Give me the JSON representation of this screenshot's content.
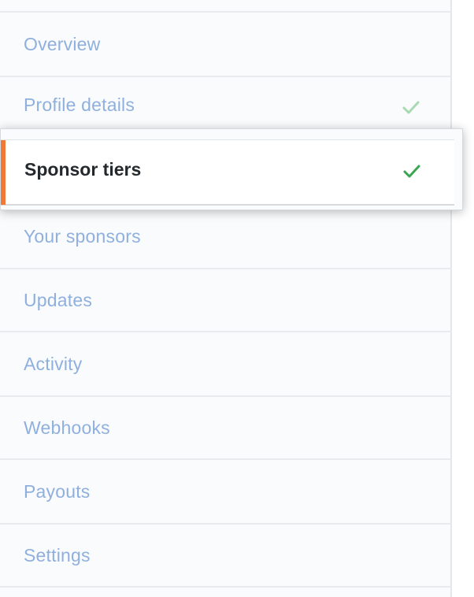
{
  "menu": {
    "items": [
      {
        "label": "Overview",
        "checked": false
      },
      {
        "label": "Profile details",
        "checked": true
      },
      {
        "label": "Sponsor tiers",
        "checked": true,
        "selected": true
      },
      {
        "label": "Your sponsors",
        "checked": false
      },
      {
        "label": "Updates",
        "checked": false
      },
      {
        "label": "Activity",
        "checked": false
      },
      {
        "label": "Webhooks",
        "checked": false
      },
      {
        "label": "Payouts",
        "checked": false
      },
      {
        "label": "Settings",
        "checked": false
      }
    ]
  },
  "colors": {
    "accent_bar": "#f0793a",
    "check_active": "#3aa552",
    "check_muted": "#a8d9b3",
    "link_text": "#8fb0df",
    "selected_text": "#24292e"
  },
  "icons": {
    "check": "check-icon"
  }
}
